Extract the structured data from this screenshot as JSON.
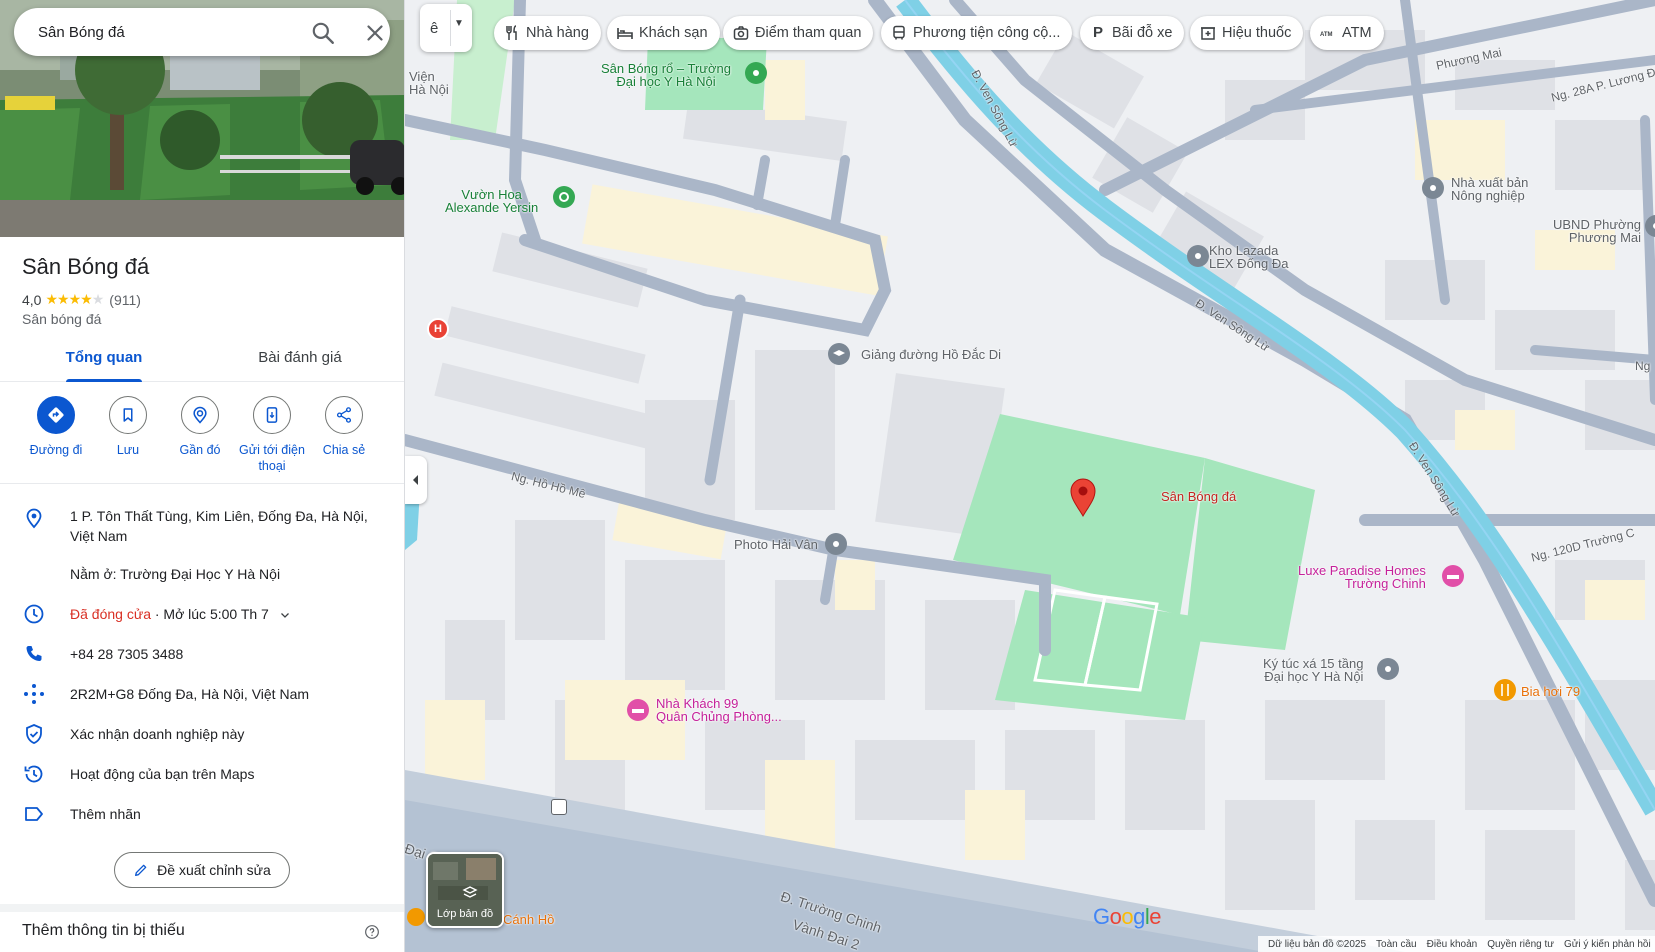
{
  "search": {
    "value": "Sân Bóng đá"
  },
  "place": {
    "name": "Sân Bóng đá",
    "rating": "4,0",
    "rating_stars": 4,
    "review_count": "(911)",
    "category": "Sân bóng đá"
  },
  "tabs": [
    {
      "label": "Tổng quan",
      "active": true
    },
    {
      "label": "Bài đánh giá",
      "active": false
    }
  ],
  "actions": [
    {
      "label": "Đường đi"
    },
    {
      "label": "Lưu"
    },
    {
      "label": "Gần đó"
    },
    {
      "label": "Gửi tới điện thoại"
    },
    {
      "label": "Chia sẻ"
    }
  ],
  "info": {
    "address": "1 P. Tôn Thất Tùng, Kim Liên, Đống Đa, Hà Nội, Việt Nam",
    "located_in": "Nằm ở: Trường Đại Học Y Hà Nội",
    "hours_status": "Đã đóng cửa",
    "hours_next": " · Mở lúc 5:00 Th 7",
    "phone": "+84 28 7305 3488",
    "plus_code": "2R2M+G8 Đống Đa, Hà Nội, Việt Nam",
    "claim": "Xác nhận doanh nghiệp này",
    "activity": "Hoạt động của bạn trên Maps",
    "add_label": "Thêm nhãn"
  },
  "suggest_edit": "Đề xuất chỉnh sửa",
  "missing_info": "Thêm thông tin bị thiếu",
  "map": {
    "lang_glyph": "ê",
    "chips": [
      {
        "label": "Nhà hàng",
        "icon": "fork-knife-icon"
      },
      {
        "label": "Khách sạn",
        "icon": "bed-icon"
      },
      {
        "label": "Điểm tham quan",
        "icon": "camera-icon"
      },
      {
        "label": "Phương tiện công cộ...",
        "icon": "bus-icon"
      },
      {
        "label": "Bãi đỗ xe",
        "icon": "parking-icon"
      },
      {
        "label": "Hiệu thuốc",
        "icon": "pharmacy-icon"
      },
      {
        "label": "ATM",
        "icon": "atm-icon"
      }
    ],
    "labels": {
      "vien_ha_noi": "Viện\nHà Nội",
      "san_bong_ro": "Sân Bóng rổ – Trường\nĐại học Y Hà Nội",
      "vuon_hoa": "Vườn Hoa\nAlexande Yersin",
      "giang_duong": "Giảng đường Hồ Đắc Di",
      "photo_hai_van": "Photo Hải Vân",
      "san_bong_da": "Sân Bóng đá",
      "luxe_paradise": "Luxe Paradise Homes\nTrường Chinh",
      "ky_tuc_xa": "Ký túc xá 15 tầng\nĐại học Y Hà Nội",
      "bia_hoi": "Bia hơi 79",
      "nha_khach": "Nhà Khách 99\nQuân Chủng Phòng...",
      "kho_lazada": "Kho Lazada\nLEX Đống Đa",
      "nxb_nong_nghiep": "Nhà xuất bản\nNông nghiệp",
      "ubnd": "UBND Phường\nPhương Mai",
      "canh_ho": "Cánh Hồ",
      "road_ven_song_lu_1": "Đ. Ven Sông Lừ",
      "road_ven_song_lu_2": "Đ. Ven Sông Lừ",
      "road_ven_song_lu_3": "Đ. Ven Sông Lừ",
      "road_ho_ho_me": "Ng. Hồ Hồ Mê",
      "road_phuong_mai": "Phương Mai",
      "road_28a": "Ng. 28A P. Lương Đ",
      "road_120d": "Ng. 120D Trường C",
      "road_truong_chinh": "Đ. Trường Chinh",
      "road_vanh_dai": "Vành Đai 2",
      "road_dai_co": "Đại Cồ",
      "road_ng": "Ng"
    },
    "layers_label": "Lớp bản đồ",
    "google": "Google",
    "footer": [
      "Dữ liệu bản đồ ©2025",
      "Toàn cầu",
      "Điều khoản",
      "Quyền riêng tư",
      "Gửi ý kiến phản hồi"
    ]
  }
}
